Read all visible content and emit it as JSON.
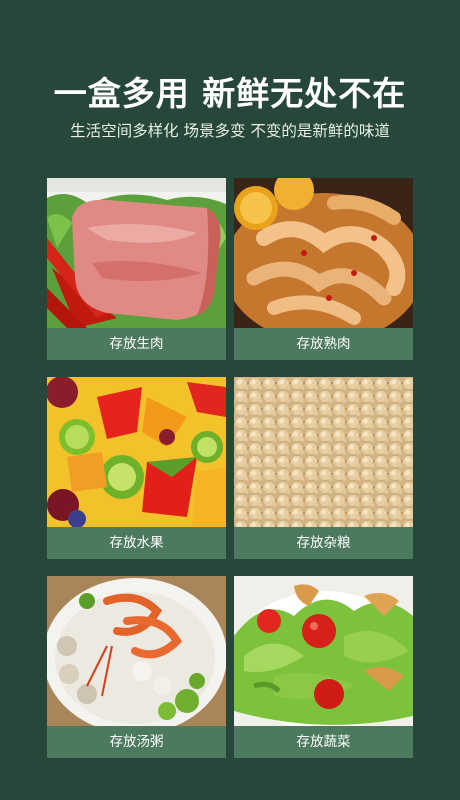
{
  "header": {
    "headline": "一盒多用 新鲜无处不在",
    "subline": "生活空间多样化 场景多变 不变的是新鲜的味道"
  },
  "cards": [
    {
      "label": "存放生肉"
    },
    {
      "label": "存放熟肉"
    },
    {
      "label": "存放水果"
    },
    {
      "label": "存放杂粮"
    },
    {
      "label": "存放汤粥"
    },
    {
      "label": "存放蔬菜"
    }
  ],
  "colors": {
    "background": "#27473a",
    "label_bar": "#4c7a5e",
    "text": "#ffffff"
  }
}
